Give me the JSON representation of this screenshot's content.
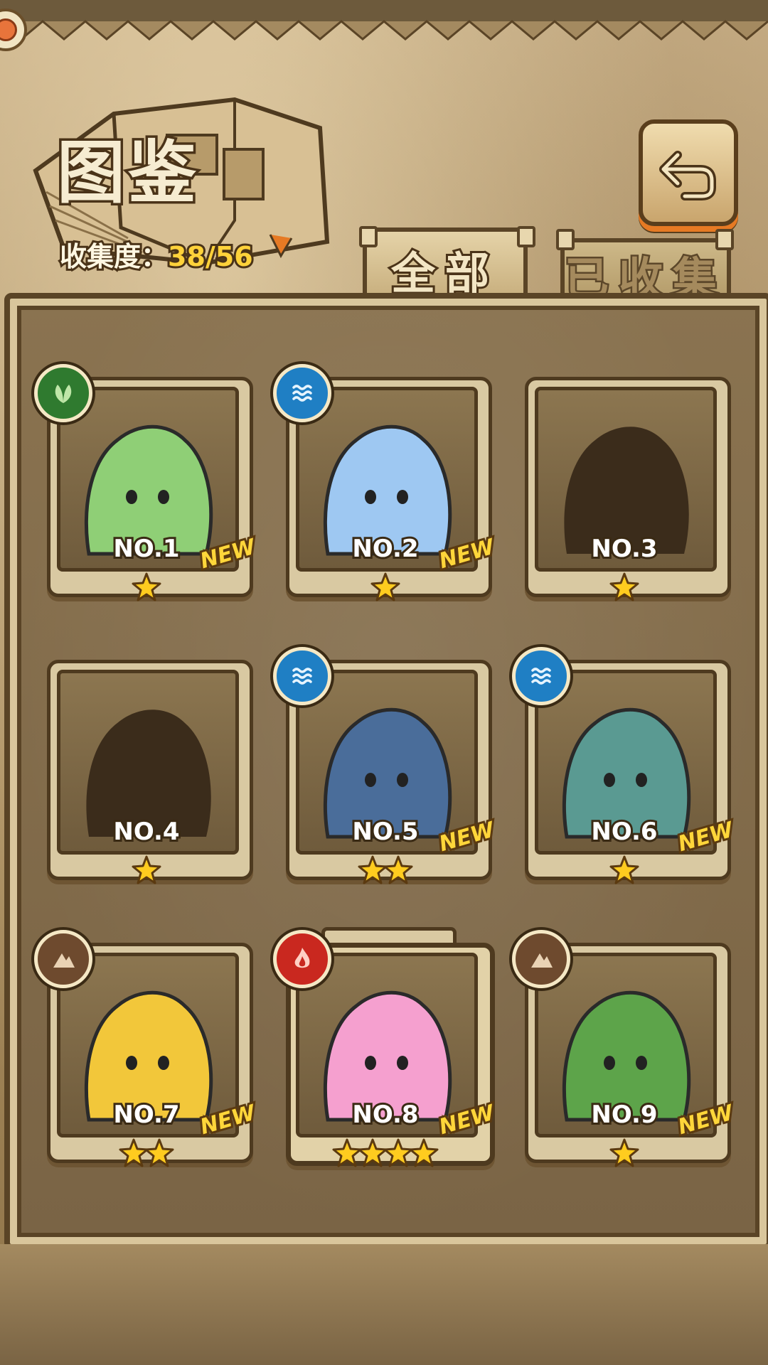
{
  "header": {
    "title": "图鉴",
    "collection_label": "收集度：",
    "collection_value": "38/56"
  },
  "tabs": [
    {
      "label": "全部",
      "active": true
    },
    {
      "label": "已收集",
      "active": false
    }
  ],
  "cards": [
    {
      "no": "NO.1",
      "element": "leaf-icon",
      "element_color": "#2f7a2f",
      "stars": 1,
      "new": true,
      "silhouette": false,
      "tint": "#8fcf76"
    },
    {
      "no": "NO.2",
      "element": "water-icon",
      "element_color": "#1f7fc4",
      "stars": 1,
      "new": true,
      "silhouette": false,
      "tint": "#9ec8f2"
    },
    {
      "no": "NO.3",
      "element": "",
      "element_color": "",
      "stars": 1,
      "new": false,
      "silhouette": true,
      "tint": "#3b2c1b"
    },
    {
      "no": "NO.4",
      "element": "",
      "element_color": "",
      "stars": 1,
      "new": false,
      "silhouette": true,
      "tint": "#3b2c1b"
    },
    {
      "no": "NO.5",
      "element": "water-icon",
      "element_color": "#1f7fc4",
      "stars": 2,
      "new": true,
      "silhouette": false,
      "tint": "#4a6d9a"
    },
    {
      "no": "NO.6",
      "element": "water-icon",
      "element_color": "#1f7fc4",
      "stars": 1,
      "new": true,
      "silhouette": false,
      "tint": "#5a9a92"
    },
    {
      "no": "NO.7",
      "element": "earth-icon",
      "element_color": "#6e4a2e",
      "stars": 2,
      "new": true,
      "silhouette": false,
      "tint": "#f2c73a"
    },
    {
      "no": "NO.8",
      "element": "fire-icon",
      "element_color": "#c9281f",
      "stars": 4,
      "new": true,
      "silhouette": false,
      "tint": "#f5a0cf",
      "special": true
    },
    {
      "no": "NO.9",
      "element": "earth-icon",
      "element_color": "#6e4a2e",
      "stars": 1,
      "new": true,
      "silhouette": false,
      "tint": "#5da44a"
    }
  ],
  "new_label": "NEW",
  "colors": {
    "star": "#ffcc1f",
    "collection_value": "#ffd23a",
    "panel_border": "#5a4426",
    "accent_orange": "#e67a24"
  }
}
